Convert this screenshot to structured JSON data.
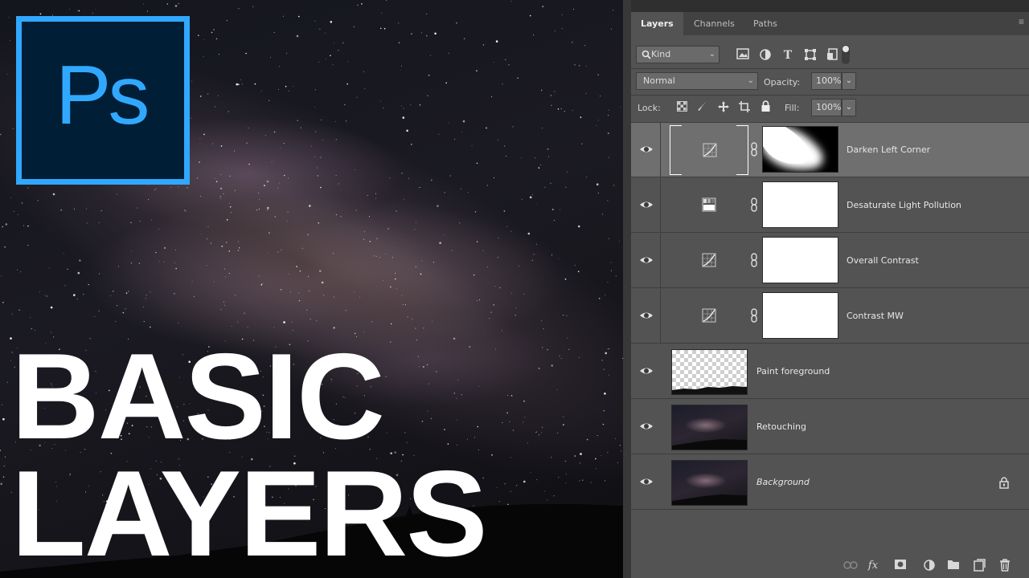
{
  "hero": {
    "logo_text": "Ps",
    "title_line1": "BASIC",
    "title_line2": "LAYERS"
  },
  "panel": {
    "tabs": [
      {
        "label": "Layers",
        "active": true
      },
      {
        "label": "Channels",
        "active": false
      },
      {
        "label": "Paths",
        "active": false
      }
    ],
    "filter": {
      "kind_label": "Kind",
      "icons": [
        "pixel-filter-icon",
        "adjustment-filter-icon",
        "type-filter-icon",
        "shape-filter-icon",
        "smart-object-filter-icon"
      ]
    },
    "blend_mode": "Normal",
    "opacity_label": "Opacity:",
    "opacity_value": "100%",
    "lock_label": "Lock:",
    "lock_icons": [
      "lock-transparent-icon",
      "lock-image-icon",
      "lock-position-icon",
      "lock-artboard-icon",
      "lock-all-icon"
    ],
    "fill_label": "Fill:",
    "fill_value": "100%",
    "layers": [
      {
        "name": "Darken Left Corner",
        "type": "curves",
        "selected": true
      },
      {
        "name": "Desaturate Light Pollution",
        "type": "hue-saturation",
        "selected": false
      },
      {
        "name": "Overall Contrast",
        "type": "curves",
        "selected": false
      },
      {
        "name": "Contrast MW",
        "type": "curves",
        "selected": false
      },
      {
        "name": "Paint foreground",
        "type": "pixel-transparent",
        "selected": false
      },
      {
        "name": "Retouching",
        "type": "pixel-image",
        "selected": false
      },
      {
        "name": "Background",
        "type": "background-locked",
        "selected": false
      }
    ],
    "bottom_icons": [
      "link-layers-icon",
      "fx-icon",
      "add-mask-icon",
      "new-adjustment-icon",
      "new-group-icon",
      "new-layer-icon",
      "delete-layer-icon"
    ]
  },
  "colors": {
    "ps_blue": "#31a8ff",
    "ps_dark": "#001e36",
    "panel_bg": "#535353",
    "selected_row": "#6f6f6f"
  }
}
